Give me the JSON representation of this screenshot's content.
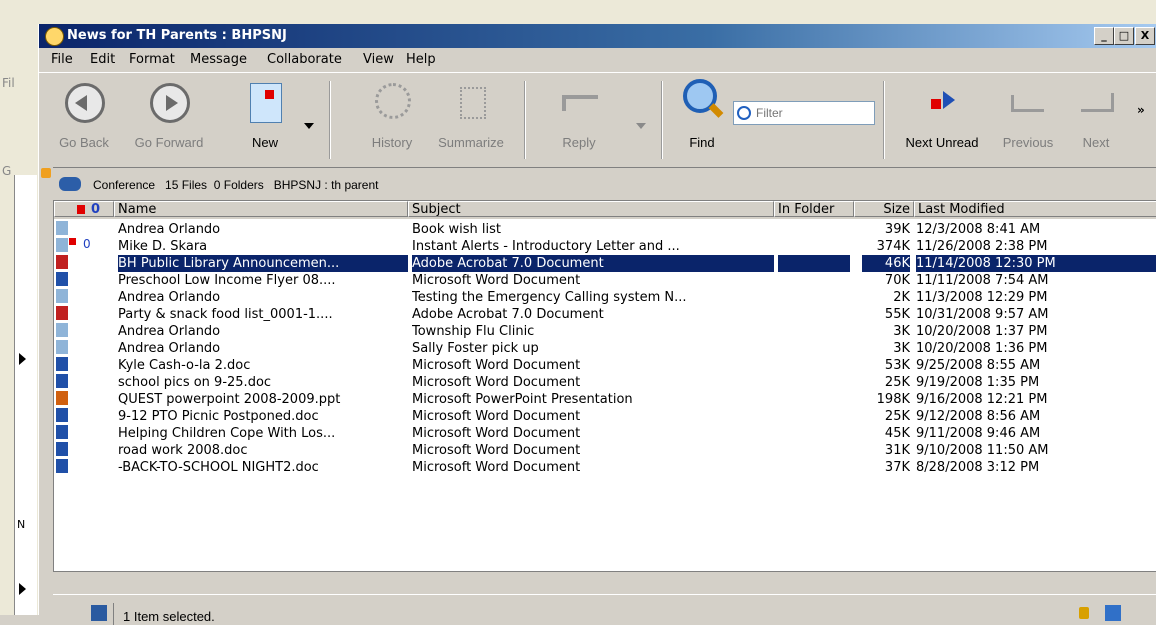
{
  "background_window": {
    "menu_file_label": "Fil",
    "go_label": "G",
    "panel_letter": "N"
  },
  "window": {
    "title": "News for TH Parents : BHPSNJ",
    "minimize": "_",
    "maximize": "□",
    "close": "X"
  },
  "menu": [
    "File",
    "Edit",
    "Format",
    "Message",
    "Collaborate",
    "View",
    "Help"
  ],
  "toolbar": {
    "go_back": "Go Back",
    "go_forward": "Go Forward",
    "new": "New",
    "history": "History",
    "summarize": "Summarize",
    "reply": "Reply",
    "find": "Find",
    "filter_placeholder": "Filter",
    "next_unread": "Next Unread",
    "previous": "Previous",
    "next": "Next"
  },
  "conference_bar": {
    "text": "Conference   15 Files  0 Folders   BHPSNJ : th parent"
  },
  "columns": {
    "name": "Name",
    "subject": "Subject",
    "in_folder": "In Folder",
    "size": "Size",
    "last_modified": "Last Modified"
  },
  "rows": [
    {
      "icon": "message-icon",
      "flag": false,
      "clip": false,
      "name": "Andrea Orlando",
      "subject": "Book wish list",
      "size": "39K",
      "date": "12/3/2008  8:41 AM"
    },
    {
      "icon": "message-icon",
      "flag": true,
      "clip": true,
      "name": "Mike D. Skara",
      "subject": " Instant Alerts - Introductory Letter and ...",
      "size": "374K",
      "date": "11/26/2008  2:38 PM"
    },
    {
      "icon": "pdf-icon",
      "flag": false,
      "clip": false,
      "name": "BH Public Library Announcemen...",
      "subject": "Adobe Acrobat 7.0 Document",
      "size": "46K",
      "date": "11/14/2008  12:30 PM",
      "selected": true
    },
    {
      "icon": "word-icon",
      "flag": false,
      "clip": false,
      "name": "Preschool Low Income Flyer 08....",
      "subject": "Microsoft Word Document",
      "size": "70K",
      "date": "11/11/2008  7:54 AM"
    },
    {
      "icon": "message-icon",
      "flag": false,
      "clip": false,
      "name": "Andrea Orlando",
      "subject": "Testing the Emergency Calling system N...",
      "size": "2K",
      "date": "11/3/2008  12:29 PM"
    },
    {
      "icon": "pdf-icon",
      "flag": false,
      "clip": false,
      "name": "Party & snack food list_0001-1....",
      "subject": "Adobe Acrobat 7.0 Document",
      "size": "55K",
      "date": "10/31/2008  9:57 AM"
    },
    {
      "icon": "message-icon",
      "flag": false,
      "clip": false,
      "name": "Andrea Orlando",
      "subject": "Township Flu Clinic",
      "size": "3K",
      "date": "10/20/2008  1:37 PM"
    },
    {
      "icon": "message-icon",
      "flag": false,
      "clip": false,
      "name": "Andrea Orlando",
      "subject": "Sally Foster pick up",
      "size": "3K",
      "date": "10/20/2008  1:36 PM"
    },
    {
      "icon": "word-icon",
      "flag": false,
      "clip": false,
      "name": "Kyle Cash-o-la 2.doc",
      "subject": "Microsoft Word Document",
      "size": "53K",
      "date": "9/25/2008  8:55 AM"
    },
    {
      "icon": "word-icon",
      "flag": false,
      "clip": false,
      "name": "school pics on 9-25.doc",
      "subject": "Microsoft Word Document",
      "size": "25K",
      "date": "9/19/2008  1:35 PM"
    },
    {
      "icon": "powerpoint-icon",
      "flag": false,
      "clip": false,
      "name": "QUEST powerpoint 2008-2009.ppt",
      "subject": "Microsoft PowerPoint Presentation",
      "size": "198K",
      "date": "9/16/2008  12:21 PM"
    },
    {
      "icon": "word-icon",
      "flag": false,
      "clip": false,
      "name": "9-12 PTO Picnic  Postponed.doc",
      "subject": "Microsoft Word Document",
      "size": "25K",
      "date": "9/12/2008  8:56 AM"
    },
    {
      "icon": "word-icon",
      "flag": false,
      "clip": false,
      "name": "Helping Children Cope With Los...",
      "subject": "Microsoft Word Document",
      "size": "45K",
      "date": "9/11/2008  9:46 AM"
    },
    {
      "icon": "word-icon",
      "flag": false,
      "clip": false,
      "name": "road work 2008.doc",
      "subject": "Microsoft Word Document",
      "size": "31K",
      "date": "9/10/2008  11:50 AM"
    },
    {
      "icon": "word-icon",
      "flag": false,
      "clip": false,
      "name": " -BACK-TO-SCHOOL NIGHT2.doc",
      "subject": "Microsoft Word Document",
      "size": "37K",
      "date": "8/28/2008  3:12 PM"
    }
  ],
  "status": {
    "text": "1 Item selected."
  },
  "colors": {
    "selection": "#0a246a",
    "titlebar": "#0a246a",
    "flag": "#e00000"
  }
}
